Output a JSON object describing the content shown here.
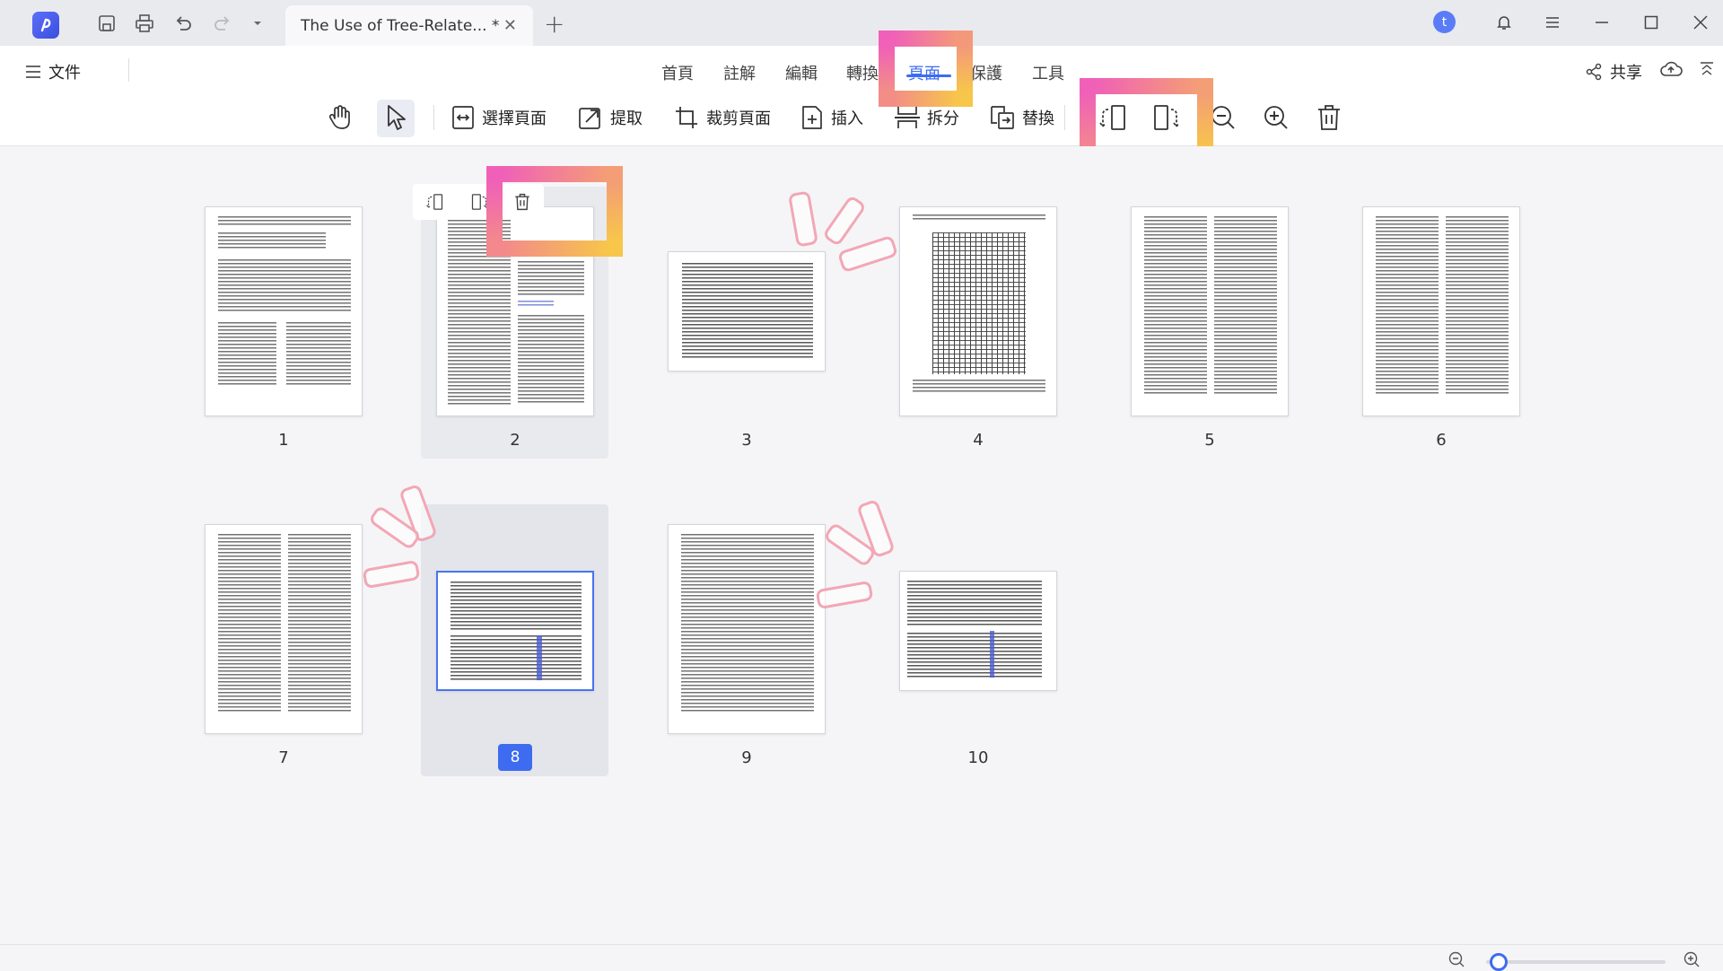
{
  "titlebar": {
    "tab_title": "The Use of Tree-Relate... *",
    "tab_close": "✕",
    "new_tab": "+",
    "avatar_letter": "t"
  },
  "menu": {
    "file_label": "文件",
    "tabs": [
      "首頁",
      "註解",
      "編輯",
      "轉換",
      "頁面",
      "保護",
      "工具"
    ],
    "active_tab": "頁面",
    "share_label": "共享"
  },
  "toolbar": {
    "select_pages": "選擇頁面",
    "extract": "提取",
    "crop_pages": "裁剪頁面",
    "insert": "插入",
    "split": "拆分",
    "replace": "替換"
  },
  "pages": [
    {
      "num": "1"
    },
    {
      "num": "2"
    },
    {
      "num": "3"
    },
    {
      "num": "4"
    },
    {
      "num": "5"
    },
    {
      "num": "6"
    },
    {
      "num": "7"
    },
    {
      "num": "8"
    },
    {
      "num": "9"
    },
    {
      "num": "10"
    }
  ],
  "selected_page": "8",
  "colors": {
    "accent": "#3d6cf0",
    "highlight_start": "#f060b8",
    "highlight_end": "#f7c64a"
  }
}
